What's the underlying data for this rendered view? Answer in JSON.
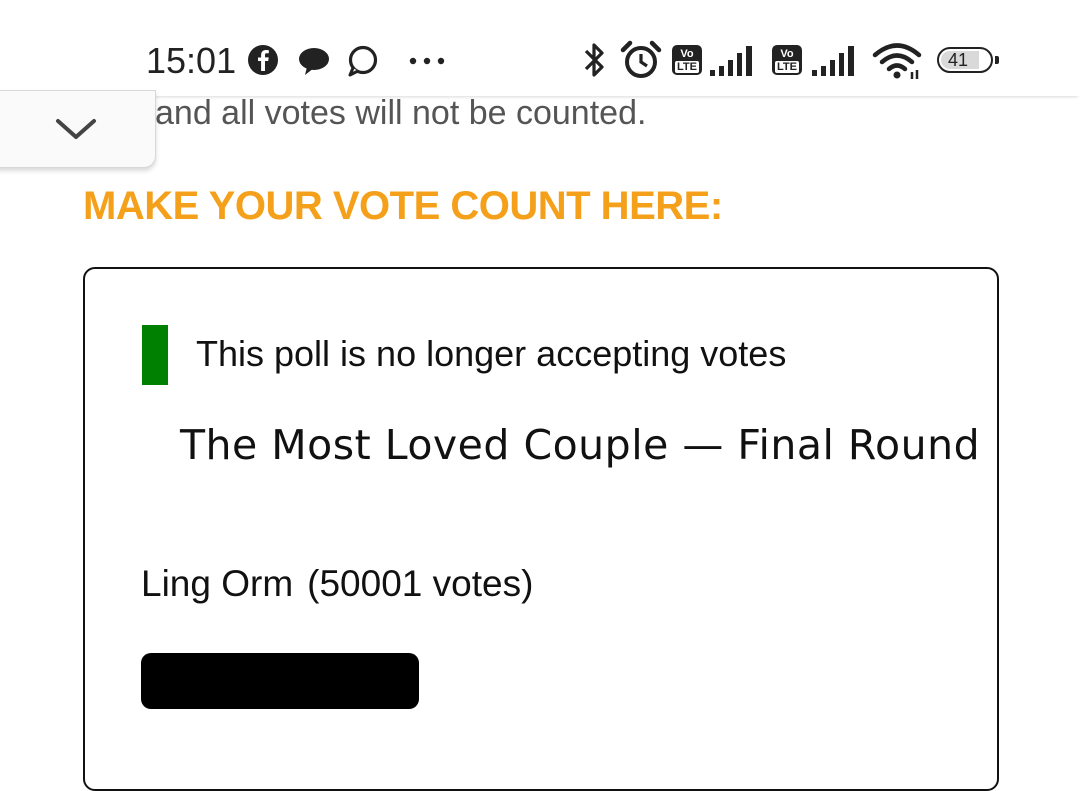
{
  "status_bar": {
    "time": "15:01",
    "notification_icons": [
      "facebook-icon",
      "chat-bubble-icon",
      "message-icon",
      "more-dots-icon"
    ],
    "system_icons": [
      "bluetooth-icon",
      "alarm-icon",
      "volte-icon",
      "signal-icon",
      "volte-icon",
      "signal-icon",
      "wifi-icon",
      "battery-icon"
    ],
    "volte_label_top": "Vo",
    "volte_label_bottom": "LTE",
    "battery_level": "41"
  },
  "page": {
    "partial_text": "and all votes will not be counted.",
    "heading": "MAKE YOUR VOTE COUNT HERE:",
    "heading_color": "#f5a01a"
  },
  "poll": {
    "notice": "This poll is no longer accepting votes",
    "notice_color": "#008000",
    "title": "The Most Loved Couple — Final Round",
    "options": [
      {
        "name": "Ling Orm",
        "votes_label": "(50001 votes)",
        "bar_fraction": 0.3
      }
    ]
  }
}
